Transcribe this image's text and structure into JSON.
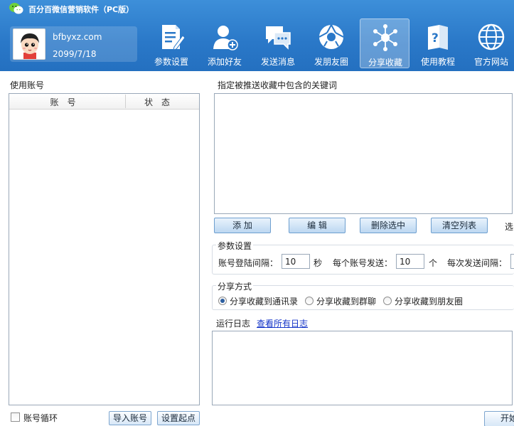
{
  "app": {
    "title": "百分百微信营销软件（PC版）"
  },
  "user": {
    "name": "bfbyxz.com",
    "date": "2099/7/18"
  },
  "nav": [
    {
      "label": "参数设置",
      "icon": "document-edit-icon"
    },
    {
      "label": "添加好友",
      "icon": "add-user-icon"
    },
    {
      "label": "发送消息",
      "icon": "chat-bubbles-icon"
    },
    {
      "label": "发朋友圈",
      "icon": "camera-aperture-icon"
    },
    {
      "label": "分享收藏",
      "icon": "share-network-icon",
      "active": true
    },
    {
      "label": "使用教程",
      "icon": "help-book-icon"
    },
    {
      "label": "官方网站",
      "icon": "globe-icon"
    }
  ],
  "accounts": {
    "section_label": "使用账号",
    "columns": [
      "账号",
      "状态"
    ],
    "rows": [],
    "loop_label": "账号循环",
    "import_button": "导入账号",
    "set_start_button": "设置起点"
  },
  "keywords": {
    "section_label": "指定被推送收藏中包含的关键词",
    "buttons": {
      "add": "添 加",
      "edit": "编 辑",
      "delete_selected": "删除选中",
      "clear_list": "清空列表"
    },
    "overflow_text": "选"
  },
  "params": {
    "title": "参数设置",
    "login_interval_label": "账号登陆间隔：",
    "login_interval_value": "10",
    "login_interval_unit": "秒",
    "per_account_label": "每个账号发送：",
    "per_account_value": "10",
    "per_account_unit": "个",
    "send_interval_label": "每次发送间隔："
  },
  "share_mode": {
    "title": "分享方式",
    "options": [
      "分享收藏到通讯录",
      "分享收藏到群聊",
      "分享收藏到朋友圈"
    ],
    "selected": 0
  },
  "log": {
    "section_label": "运行日志",
    "view_all_link": "查看所有日志"
  },
  "start_button": "开始",
  "colors": {
    "header_blue": "#2a78c8",
    "button_blue": "#bcd7f1",
    "link_blue": "#1535c8"
  }
}
